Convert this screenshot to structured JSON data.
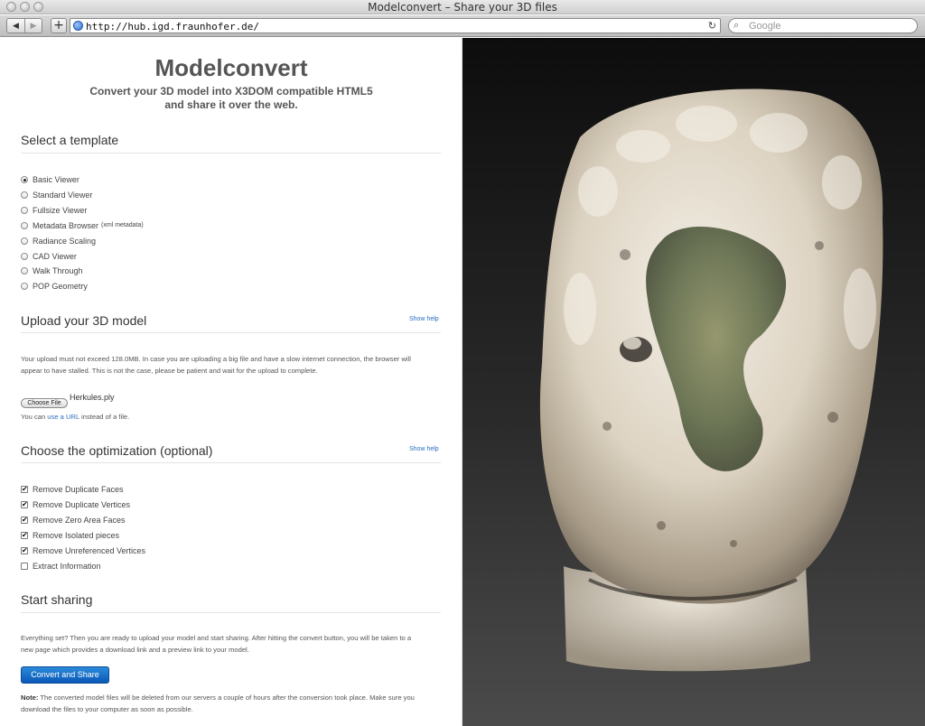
{
  "browser": {
    "window_title": "Modelconvert – Share your 3D files",
    "url": "http://hub.igd.fraunhofer.de/",
    "search_placeholder": "Google",
    "back_icon": "back-arrow-icon",
    "forward_icon": "forward-arrow-icon",
    "add_icon": "plus-icon",
    "reload_icon": "reload-icon",
    "search_icon": "search-icon"
  },
  "hero": {
    "title": "Modelconvert",
    "subtitle_line1": "Convert your 3D model into X3DOM compatible HTML5",
    "subtitle_line2": "and share it over the web."
  },
  "template_section": {
    "title": "Select a template",
    "options": [
      {
        "label": "Basic Viewer",
        "note": "",
        "selected": true
      },
      {
        "label": "Standard Viewer",
        "note": "",
        "selected": false
      },
      {
        "label": "Fullsize Viewer",
        "note": "",
        "selected": false
      },
      {
        "label": "Metadata Browser",
        "note": "(xml metadata)",
        "selected": false
      },
      {
        "label": "Radiance Scaling",
        "note": "",
        "selected": false
      },
      {
        "label": "CAD Viewer",
        "note": "",
        "selected": false
      },
      {
        "label": "Walk Through",
        "note": "",
        "selected": false
      },
      {
        "label": "POP Geometry",
        "note": "",
        "selected": false
      }
    ]
  },
  "upload_section": {
    "title": "Upload your 3D model",
    "show_help": "Show help",
    "info_line1": "Your upload must not exceed 128.0MB. In case you are uploading a big file and have a slow internet connection, the browser will",
    "info_line2": "appear to have stalled. This is not the case, please be patient and wait for the upload to complete.",
    "choose_file_label": "Choose File",
    "file_name": "Herkules.ply",
    "url_prefix": "You can",
    "url_link": "use a URL",
    "url_suffix": "instead of a file."
  },
  "optimization_section": {
    "title": "Choose the optimization (optional)",
    "show_help": "Show help",
    "options": [
      {
        "label": "Remove Duplicate Faces",
        "checked": true
      },
      {
        "label": "Remove Duplicate Vertices",
        "checked": true
      },
      {
        "label": "Remove Zero Area Faces",
        "checked": true
      },
      {
        "label": "Remove Isolated pieces",
        "checked": true
      },
      {
        "label": "Remove Unreferenced Vertices",
        "checked": true
      },
      {
        "label": "Extract Information",
        "checked": false
      }
    ]
  },
  "sharing_section": {
    "title": "Start sharing",
    "info_line1": "Everything set? Then you are ready to upload your model and start sharing. After hitting the convert button, you will be taken to a",
    "info_line2": "new page which provides a download link and a preview link to your model.",
    "convert_button": "Convert and Share",
    "note_label": "Note:",
    "note_line1": "The converted model files will be deleted from our servers a couple of hours after the conversion took place. Make sure you",
    "note_line2": "download the files to your computer as soon as possible."
  },
  "viewer": {
    "model_name": "Herkules.ply",
    "icon": "3d-model-preview"
  }
}
